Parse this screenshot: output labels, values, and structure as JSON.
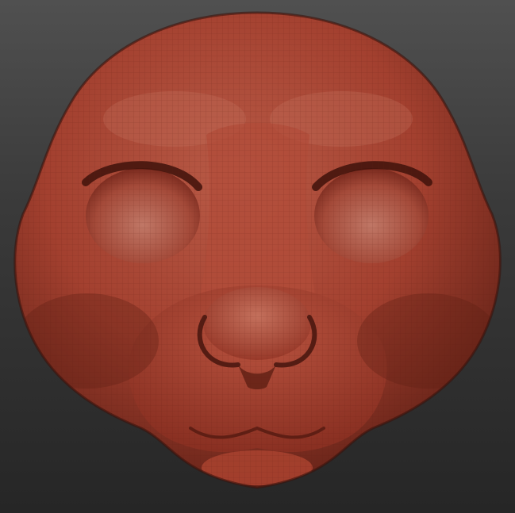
{
  "viewport": {
    "background_top": "#505050",
    "background_bottom": "#262626"
  },
  "model": {
    "subject": "sculpted-animal-head",
    "material_color": "#a3402f",
    "highlight_color": "#d98a78",
    "shadow_color": "#4a1710",
    "wireframe_visible": true
  }
}
